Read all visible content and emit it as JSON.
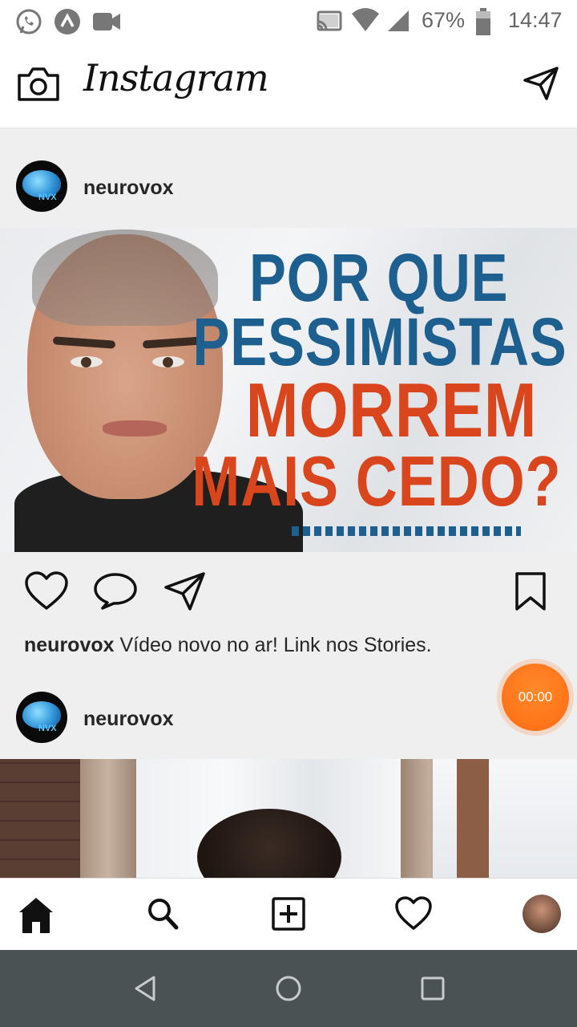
{
  "status_bar": {
    "battery": "67%",
    "time": "14:47"
  },
  "app": {
    "title": "Instagram"
  },
  "feed": {
    "posts": [
      {
        "username": "neurovox",
        "avatar_text": "NVX",
        "image_headline": [
          "POR QUE",
          "PESSIMISTAS",
          "MORREM",
          "MAIS CEDO?"
        ],
        "caption_user": "neurovox",
        "caption_text": "Vídeo novo no ar! Link nos Stories."
      },
      {
        "username": "neurovox",
        "avatar_text": "NVX"
      }
    ]
  },
  "timer": {
    "value": "00:00"
  },
  "colors": {
    "accent_orange": "#ff6a12",
    "headline_blue": "#1d5f8f",
    "headline_red": "#d9451c"
  },
  "icons": {
    "status": [
      "whatsapp-icon",
      "app-icon",
      "video-camera-icon",
      "cast-icon",
      "wifi-icon",
      "signal-icon",
      "battery-icon"
    ],
    "top": [
      "camera-icon",
      "direct-message-icon"
    ],
    "actions": [
      "like-heart-icon",
      "comment-icon",
      "share-icon",
      "bookmark-icon"
    ],
    "bottom_nav": [
      "home-icon",
      "search-icon",
      "add-post-icon",
      "activity-heart-icon",
      "profile-avatar"
    ],
    "system_nav": [
      "back-icon",
      "home-circle-icon",
      "recents-icon"
    ]
  }
}
